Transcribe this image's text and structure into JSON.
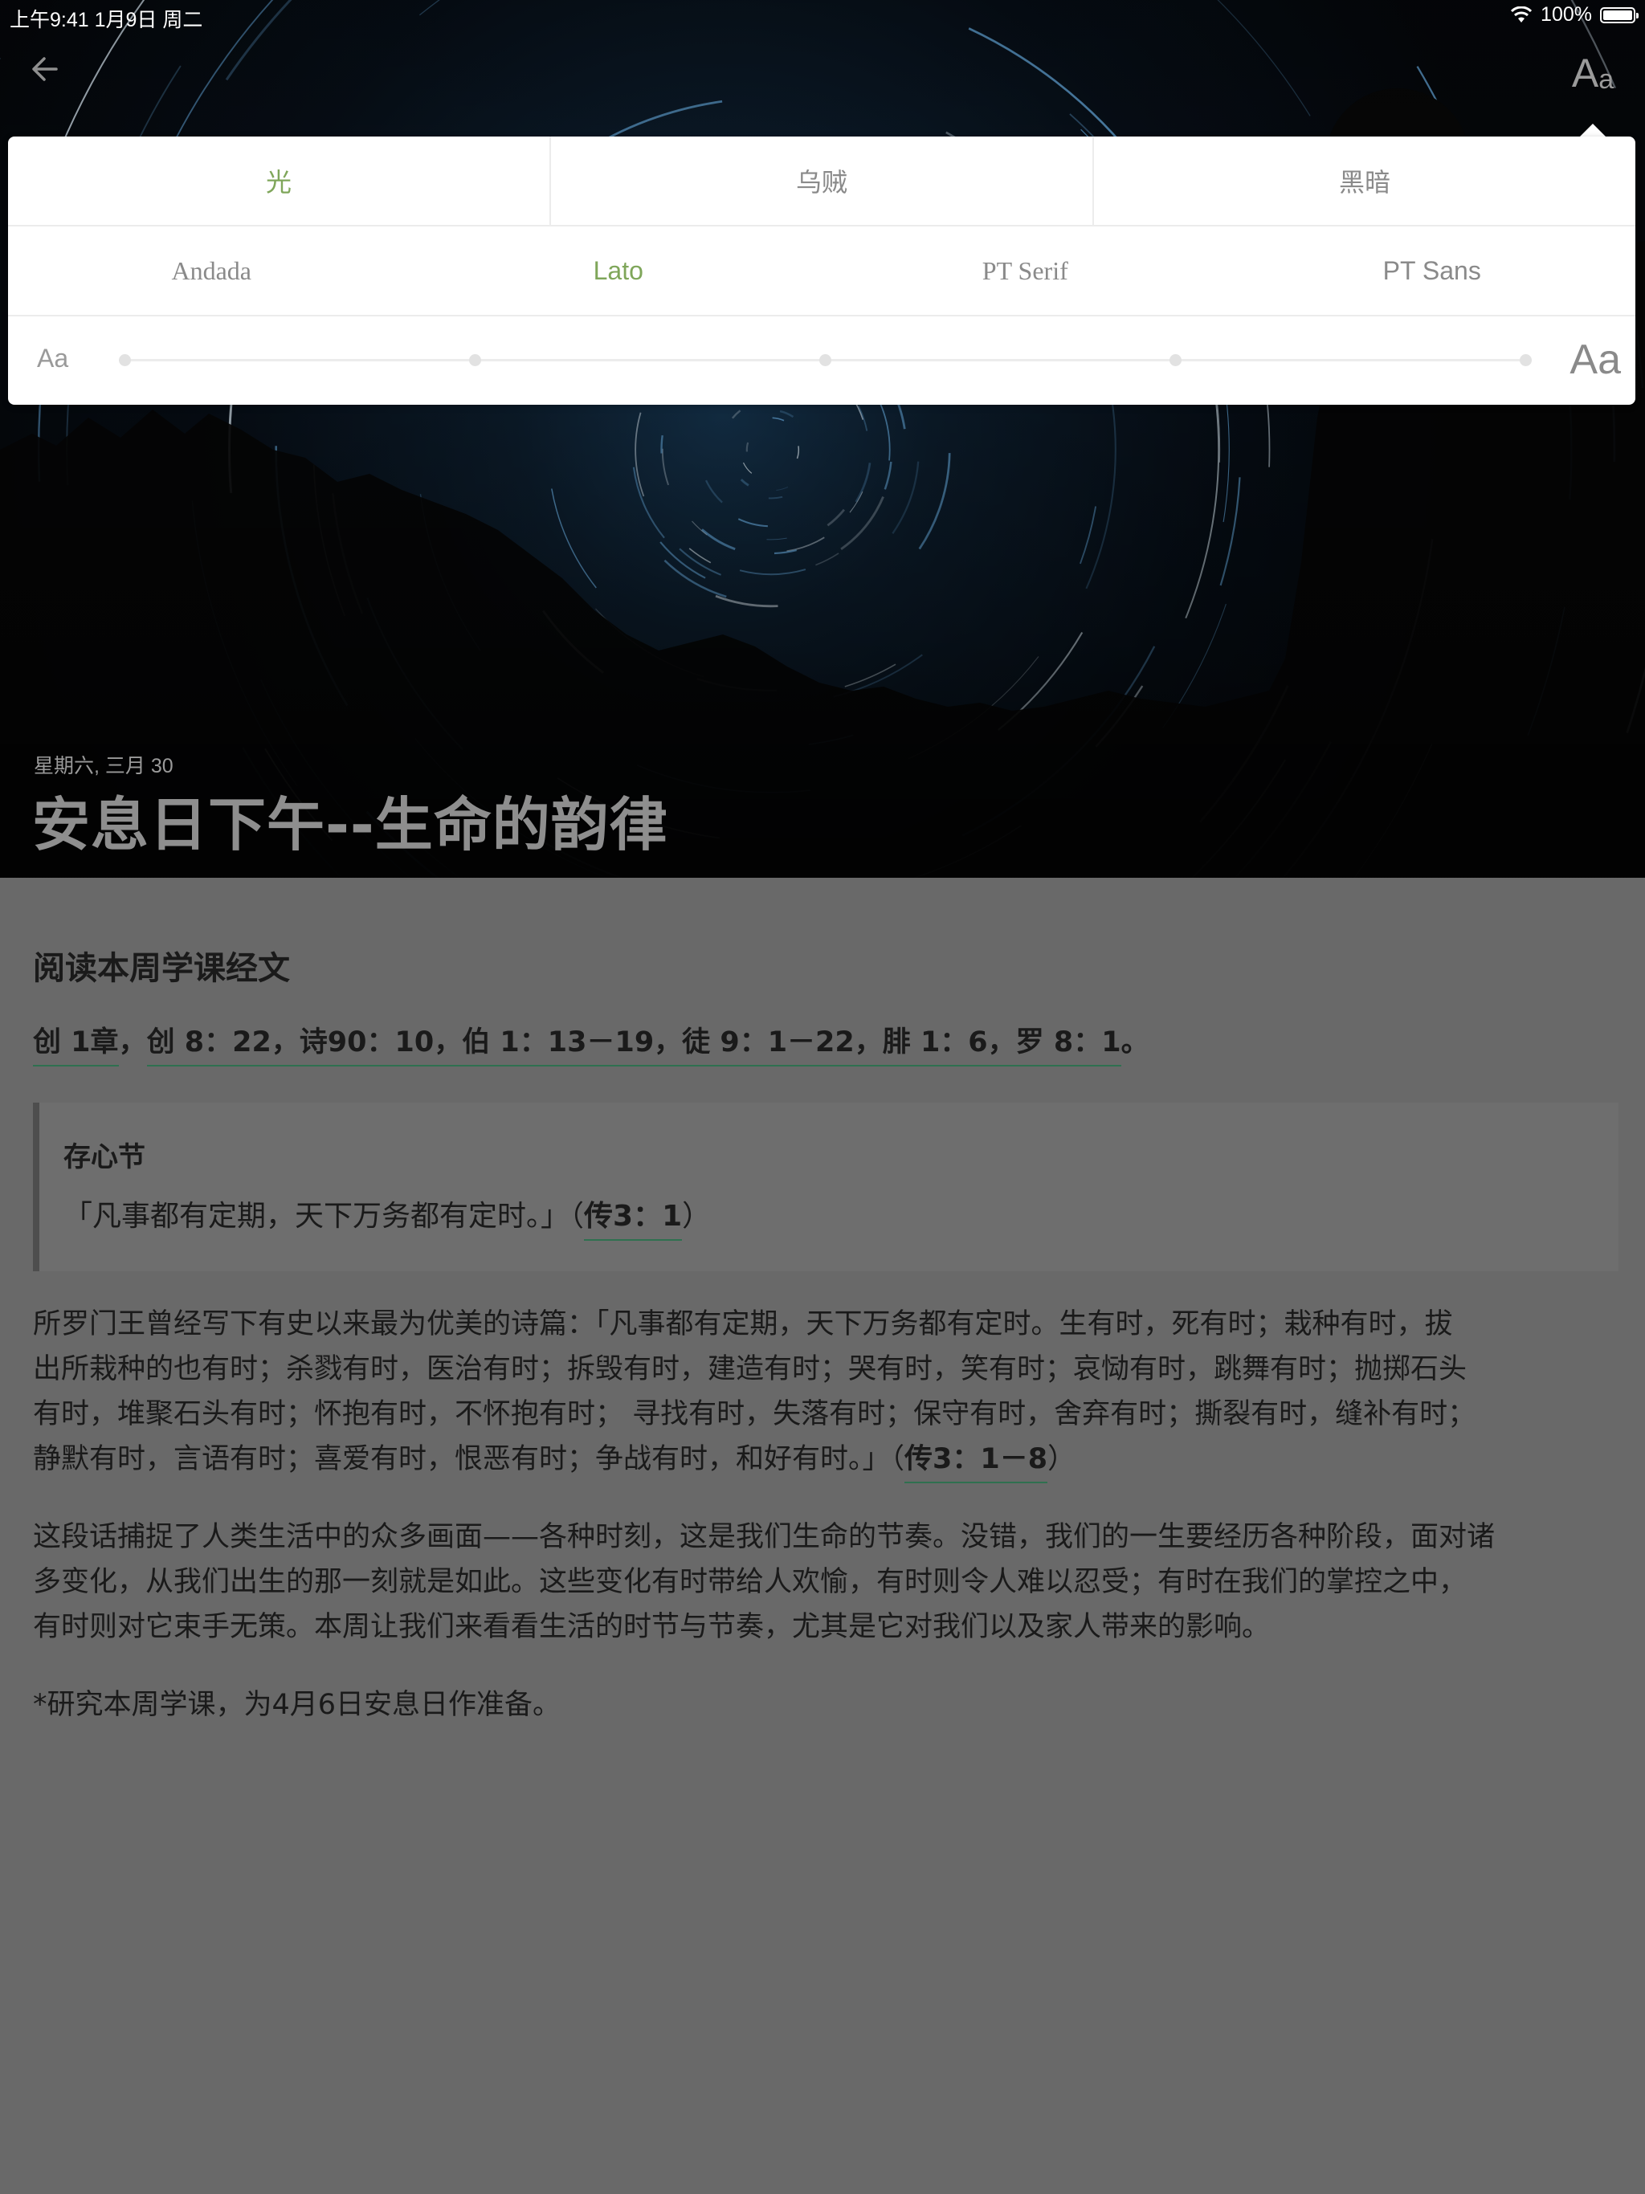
{
  "status_bar": {
    "time_date": "上午9:41   1月9日 周二",
    "battery": "100%"
  },
  "header": {
    "back_icon": "arrow-left-icon",
    "settings_icon": "text-size-icon",
    "settings_label_big": "A",
    "settings_label_small": "a"
  },
  "settings": {
    "themes": [
      "光",
      "乌贼",
      "黑暗"
    ],
    "active_theme": 0,
    "fonts": [
      "Andada",
      "Lato",
      "PT Serif",
      "PT Sans"
    ],
    "active_font": 1,
    "size_small_label": "Aa",
    "size_large_label": "Aa",
    "size_steps": 5,
    "selected_size_step": 0
  },
  "hero": {
    "date": "星期六, 三月 30",
    "title": "安息日下午--生命的韵律"
  },
  "content": {
    "section_heading": "阅读本周学课经文",
    "refs_part1": "创 1章",
    "refs_sep": "，",
    "refs_part2": "创 8：22，诗90：10，伯 1：13－19，徒 9：1－22，腓 1：6，罗 8：1",
    "refs_end": "。",
    "memory_title": "存心节",
    "memory_text": "「凡事都有定期，天下万务都有定时。」（",
    "memory_ref": "传3：1",
    "memory_close": "）",
    "para1_lines": [
      "所罗门王曾经写下有史以来最为优美的诗篇：「凡事都有定期，天下万务都有定时。生有时，死有时；栽种有时，拔",
      "出所栽种的也有时；杀戮有时，医治有时；拆毁有时，建造有时；哭有时，笑有时；哀恸有时，跳舞有时；抛掷石头",
      "有时，堆聚石头有时；怀抱有时，不怀抱有时； 寻找有时，失落有时；保守有时，舍弃有时；撕裂有时，缝补有时；"
    ],
    "para1_last": "静默有时，言语有时；喜爱有时，恨恶有时；争战有时，和好有时。」（",
    "para1_ref": "传3：1－8",
    "para1_close": "）",
    "para2_lines": [
      "这段话捕捉了人类生活中的众多画面——各种时刻，这是我们生命的节奏。没错，我们的一生要经历各种阶段，面对诸",
      "多变化，从我们出生的那一刻就是如此。这些变化有时带给人欢愉，有时则令人难以忍受；有时在我们的掌控之中，",
      "有时则对它束手无策。本周让我们来看看生活的时节与节奏，尤其是它对我们以及家人带来的影响。"
    ],
    "para3": "*研究本周学课，为4月6日安息日作准备。"
  },
  "colors": {
    "accent": "#7fa65a",
    "link_underline": "#2f7050",
    "content_bg": "#696969"
  }
}
